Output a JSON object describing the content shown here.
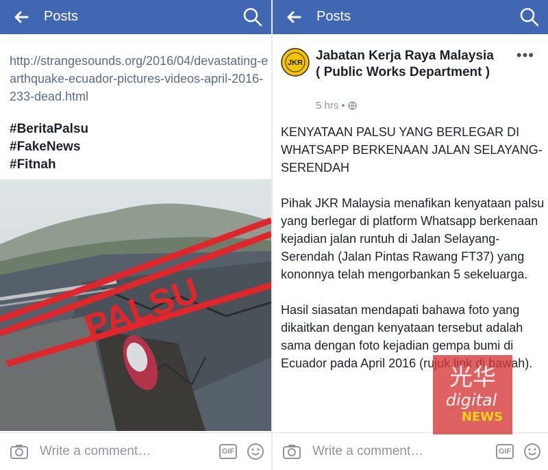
{
  "left_panel": {
    "header": {
      "title": "Posts"
    },
    "link_text": "http://strangesounds.org/2016/04/devastating-earthquake-ecuador-pictures-videos-april-2016-233-dead.html",
    "hashtags": [
      "#BeritaPalsu",
      "#FakeNews",
      "#Fitnah"
    ],
    "photo_stamp": "PALSU",
    "comment_bar": {
      "placeholder": "Write a comment…",
      "gif_label": "GIF"
    }
  },
  "right_panel": {
    "header": {
      "title": "Posts"
    },
    "post": {
      "logo_text": "JKR",
      "page_name": "Jabatan Kerja Raya Malaysia ( Public Works Department )",
      "time": "5 hrs",
      "separator": "•",
      "paragraphs": [
        "KENYATAAN PALSU YANG BERLEGAR DI WHATSAPP BERKENAAN JALAN SELAYANG-SERENDAH",
        "Pihak JKR Malaysia menafikan kenyataan palsu yang berlegar di platform Whatsapp berkenaan kejadian jalan runtuh di Jalan Selayang-Serendah (Jalan Pintas Rawang FT37) yang kononnya telah mengorbankan 5 sekeluarga.",
        "Hasil siasatan mendapati bahawa foto yang dikaitkan dengan kenyataan tersebut adalah sama dengan foto kejadian gempa bumi di Ecuador pada April 2016 (rujuk link di bawah)."
      ]
    },
    "watermark": {
      "line1": "光华",
      "line2": "digital",
      "line3": "NEWS"
    },
    "comment_bar": {
      "placeholder": "Write a comment…",
      "gif_label": "GIF"
    }
  },
  "colors": {
    "header_bg": "#4267b2",
    "link": "#5a6b91",
    "text": "#1d2129",
    "muted": "#90949c",
    "stamp_red": "#e0262b",
    "logo_yellow": "#f5c400"
  }
}
